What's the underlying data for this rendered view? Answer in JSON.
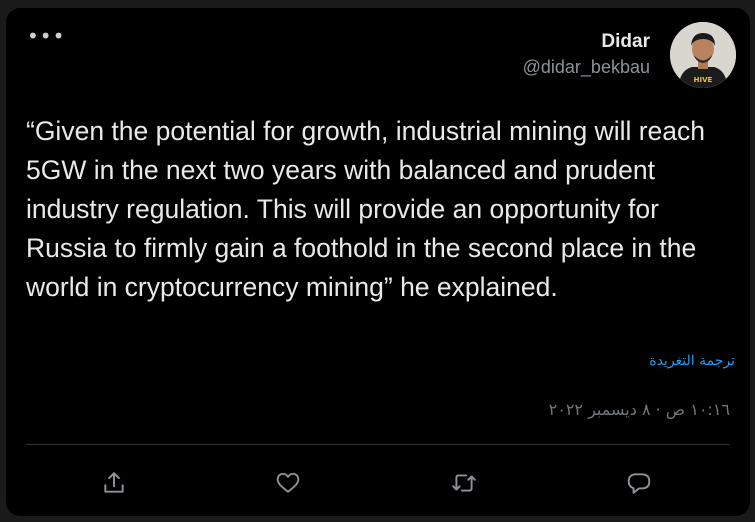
{
  "tweet": {
    "author_name": "Didar",
    "author_handle": "@didar_bekbau",
    "text": "“Given the potential for growth, industrial mining will reach 5GW in the next two years with balanced and prudent industry regulation. This will provide an opportunity for Russia to firmly gain a foothold in the second place in the world in cryptocurrency mining” he explained.",
    "translate_label": "ترجمة التغريدة",
    "timestamp": "١٠:١٦ ص · ٨ ديسمبر ٢٠٢٢",
    "more_label": "•••",
    "avatar_shirt_text": "HIVE"
  },
  "actions": [
    {
      "name": "share",
      "icon": "share-icon"
    },
    {
      "name": "like",
      "icon": "heart-icon"
    },
    {
      "name": "retweet",
      "icon": "retweet-icon"
    },
    {
      "name": "reply",
      "icon": "reply-icon"
    }
  ],
  "colors": {
    "background": "#000000",
    "text": "#e7e9ea",
    "secondary": "#8b9399",
    "link": "#1d9bf0",
    "divider": "#2f3336"
  }
}
